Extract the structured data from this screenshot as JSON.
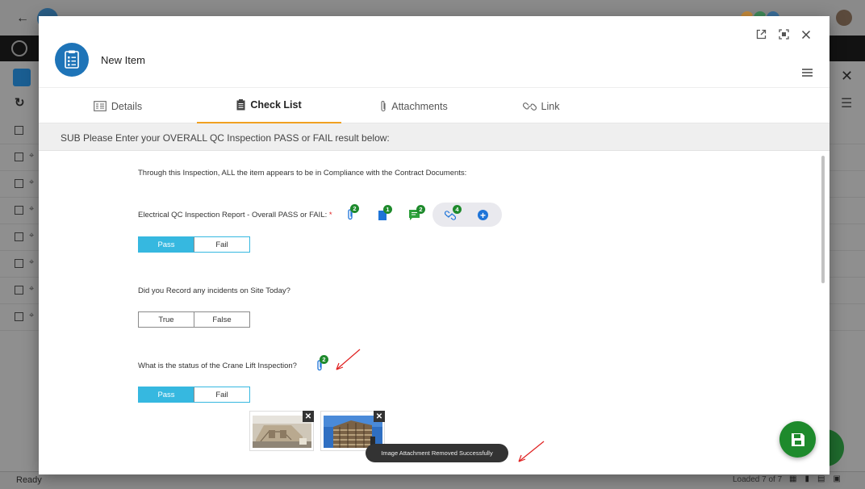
{
  "background": {
    "status_left": "Ready",
    "status_right": "Loaded 7 of 7"
  },
  "modal": {
    "title": "New Item",
    "tabs": [
      {
        "label": "Details",
        "icon": "details-icon",
        "active": false
      },
      {
        "label": "Check List",
        "icon": "clipboard-icon",
        "active": true
      },
      {
        "label": "Attachments",
        "icon": "paperclip-icon",
        "active": false
      },
      {
        "label": "Link",
        "icon": "link-icon",
        "active": false
      }
    ],
    "section_header": "SUB Please Enter your OVERALL QC Inspection PASS or FAIL result below:",
    "intro": "Through this Inspection, ALL the item appears to be in Compliance with the Contract Documents:",
    "questions": [
      {
        "label": "Electrical QC Inspection Report - Overall PASS or FAIL:",
        "required_mark": "*",
        "options": [
          "Pass",
          "Fail"
        ],
        "selected": "Pass",
        "badges": {
          "attachments": "2",
          "documents": "1",
          "comments": "2",
          "links": "4"
        }
      },
      {
        "label": "Did you Record any incidents on Site Today?",
        "options": [
          "True",
          "False"
        ],
        "selected": null
      },
      {
        "label": "What is the status of the Crane Lift Inspection?",
        "options": [
          "Pass",
          "Fail"
        ],
        "selected": "Pass",
        "badges": {
          "attachments": "2"
        }
      }
    ],
    "toast": "Image Attachment Removed Successfully"
  },
  "colors": {
    "accent_tab": "#f0a020",
    "selected_option": "#36b8e0",
    "badge": "#1e8a2c",
    "save_button": "#1e8a2c",
    "arrow": "#e02020"
  }
}
